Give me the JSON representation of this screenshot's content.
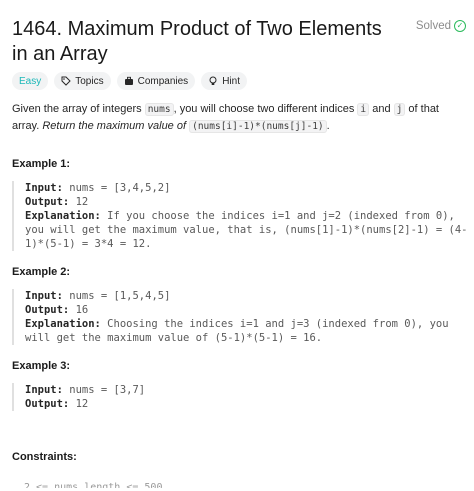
{
  "problem": {
    "title": "1464. Maximum Product of Two Elements in an Array",
    "status": "Solved",
    "tags": [
      {
        "label": "Easy"
      },
      {
        "label": "Topics",
        "icon": "tag-icon"
      },
      {
        "label": "Companies",
        "icon": "briefcase-icon"
      },
      {
        "label": "Hint",
        "icon": "lightbulb-icon"
      }
    ],
    "desc": {
      "p1": "Given the array of integers ",
      "c1": "nums",
      "p2": ", you will choose two different indices ",
      "c2": "i",
      "p3": " and ",
      "c3": "j",
      "p4": " of that array. ",
      "it1": "Return the maximum value of",
      "c4": "(nums[i]-1)*(nums[j]-1)",
      "p5": "."
    }
  },
  "examples": [
    {
      "heading": "Example 1:",
      "input_label": "Input:",
      "input": " nums = [3,4,5,2]",
      "output_label": "Output:",
      "output": " 12",
      "expl_label": "Explanation:",
      "expl": " If you choose the indices i=1 and j=2 (indexed from 0), you will get the maximum value, that is, (nums[1]-1)*(nums[2]-1) = (4-1)*(5-1) = 3*4 = 12."
    },
    {
      "heading": "Example 2:",
      "input_label": "Input:",
      "input": " nums = [1,5,4,5]",
      "output_label": "Output:",
      "output": " 16",
      "expl_label": "Explanation:",
      "expl": " Choosing the indices i=1 and j=3 (indexed from 0), you will get the maximum value of (5-1)*(5-1) = 16."
    },
    {
      "heading": "Example 3:",
      "input_label": "Input:",
      "input": " nums = [3,7]",
      "output_label": "Output:",
      "output": " 12"
    }
  ],
  "constraints": {
    "heading": "Constraints:",
    "partial_line": "2 <= nums.length <= 500"
  }
}
